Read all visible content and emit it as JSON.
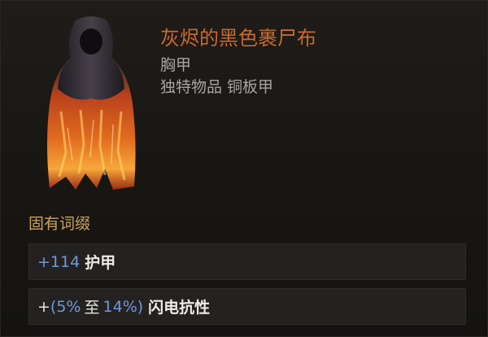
{
  "item": {
    "name": "灰烬的黑色裹尸布",
    "slot": "胸甲",
    "type": "独特物品 铜板甲",
    "name_color": "#c86a28",
    "icon": "black-shroud-robe-icon"
  },
  "implicit": {
    "title": "固有词缀",
    "mods": [
      {
        "prefix": "+",
        "value": "114",
        "label": "护甲"
      },
      {
        "prefix": "+",
        "open": "(",
        "min": "5%",
        "to": "至",
        "max": "14%",
        "close": ")",
        "label": "闪电抗性"
      }
    ]
  },
  "colors": {
    "value_blue": "#6f97de",
    "section_gold": "#c9a25a",
    "text_grey": "#a7a4a0"
  }
}
